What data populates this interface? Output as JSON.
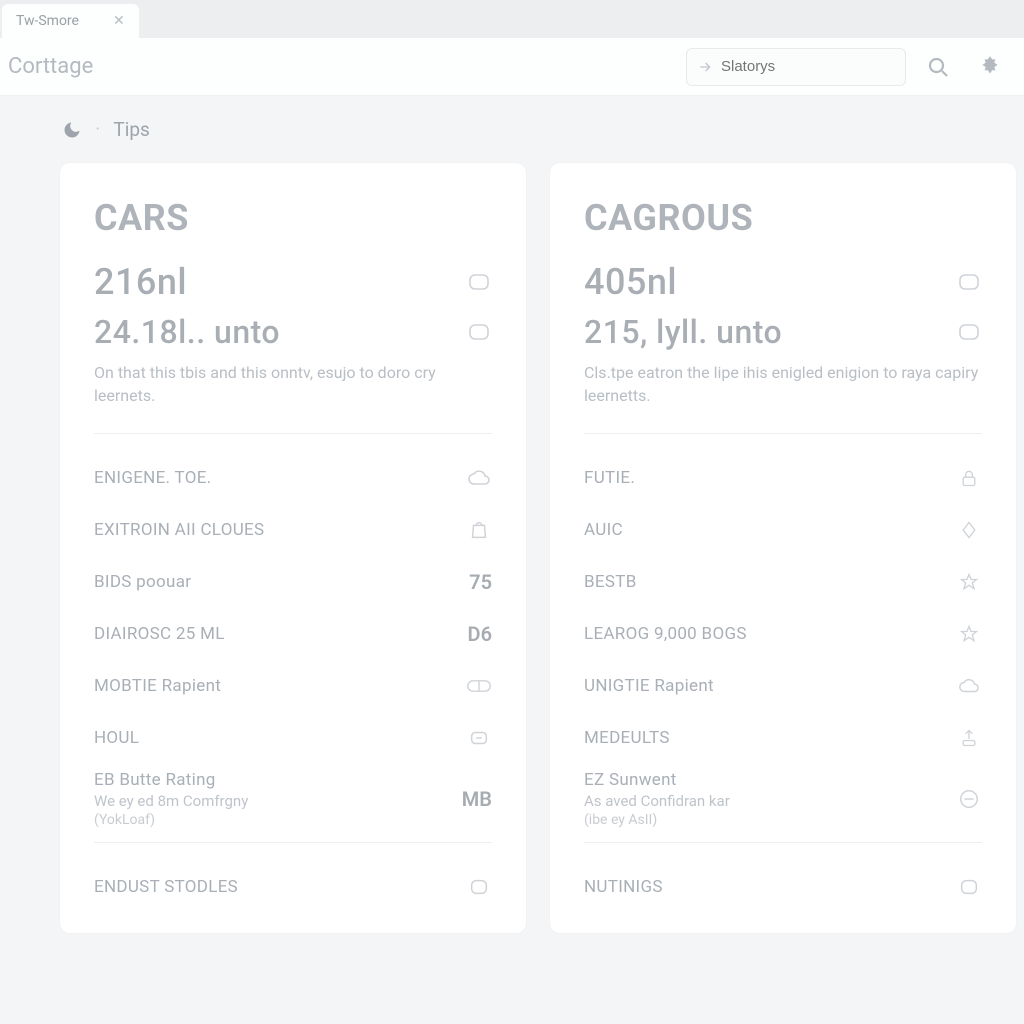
{
  "tab": {
    "title": "Tw-Smore"
  },
  "app": {
    "title": "Corttage"
  },
  "search": {
    "placeholder": "Slatorys"
  },
  "breadcrumb": {
    "item": "Tips"
  },
  "cards": [
    {
      "title": "CARS",
      "big1": "216nl",
      "big2": "24.18l.. unto",
      "desc": "On that this tbis and this onntv, esujo to doro cry leernets.",
      "items": [
        {
          "label": "ENIGENE. TOE.",
          "icon": "cloud"
        },
        {
          "label": "EXITROIN AII CLOUES",
          "icon": "bag"
        },
        {
          "label": "BIDS poouar",
          "value": "75"
        },
        {
          "label": "DIAIROSC 25 ML",
          "value": "D6"
        },
        {
          "label": "MOBTIE Rapient",
          "icon": "pill"
        },
        {
          "label": "HOUL",
          "icon": "box"
        },
        {
          "label": "EB Butte Rating",
          "sub": "We ey ed 8m Comfrgny",
          "sub2": "(YokLoaf)",
          "value": "MB"
        }
      ],
      "section2_title": "ENDUST STODLES"
    },
    {
      "title": "CAGROUS",
      "big1": "405nl",
      "big2": "215, lyll. unto",
      "desc": "Cls.tpe eatron the lipe ihis enigled enigion to raya capiry leernetts.",
      "items": [
        {
          "label": "FUTIE.",
          "icon": "lock"
        },
        {
          "label": "AUIC",
          "icon": "diamond"
        },
        {
          "label": "BESTB",
          "icon": "star"
        },
        {
          "label": "LEAROG 9,000 BOGS",
          "icon": "star"
        },
        {
          "label": "UNIGTIE Rapient",
          "icon": "cloud"
        },
        {
          "label": "MEDEULTS",
          "icon": "upload"
        },
        {
          "label": "EZ Sunwent",
          "sub": "As aved Confidran kar",
          "sub2": "(ibe ey AsII)",
          "icon": "minus"
        }
      ],
      "section2_title": "NUTINIGS"
    }
  ]
}
